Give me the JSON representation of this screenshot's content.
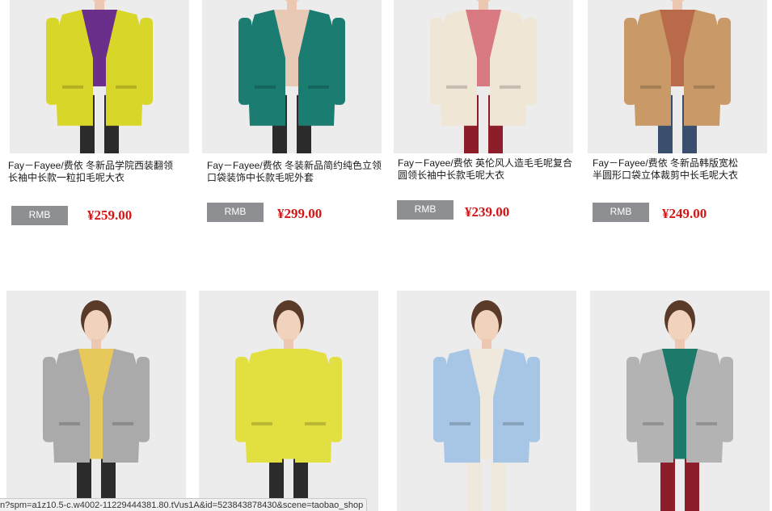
{
  "products": [
    {
      "title": "Fay－Fayee/费依 冬新品学院西装翻领\n长袖中长款一粒扣毛呢大衣",
      "currency_label": "RMB",
      "price": "¥259.00",
      "coat_color": "#d9d62a",
      "inner_color": "#6a2f8a",
      "leg_color": "#2b2b2b"
    },
    {
      "title": "Fay－Fayee/费依 冬装新品简约纯色立领\n口袋装饰中长款毛呢外套",
      "currency_label": "RMB",
      "price": "¥299.00",
      "coat_color": "#1b7c72",
      "inner_color": "#e8c9b6",
      "leg_color": "#2b2b2b"
    },
    {
      "title": "Fay－Fayee/费依 英伦风人造毛毛呢复合\n圆领长袖中长款毛呢大衣",
      "currency_label": "RMB",
      "price": "¥239.00",
      "coat_color": "#efe6d6",
      "inner_color": "#d97a82",
      "leg_color": "#8e1d2a"
    },
    {
      "title": "Fay－Fayee/费依 冬新品韩版宽松\n半圆形口袋立体裁剪中长毛呢大衣",
      "currency_label": "RMB",
      "price": "¥249.00",
      "coat_color": "#c99a68",
      "inner_color": "#b86a4a",
      "leg_color": "#3a4e6e"
    },
    {
      "coat_color": "#a9aaa9",
      "inner_color": "#e7c85a",
      "leg_color": "#2b2b2b"
    },
    {
      "coat_color": "#e2e040",
      "inner_color": "#e2e040",
      "leg_color": "#2b2b2b"
    },
    {
      "coat_color": "#a7c6e6",
      "inner_color": "#efe8dc",
      "leg_color": "#efe8dc"
    },
    {
      "coat_color": "#b3b3b3",
      "inner_color": "#1d7a6a",
      "leg_color": "#8e1d2a"
    }
  ],
  "status_url": "n?spm=a1z10.5-c.w4002-11229444381.80.tVus1A&id=523843878430&scene=taobao_shop"
}
